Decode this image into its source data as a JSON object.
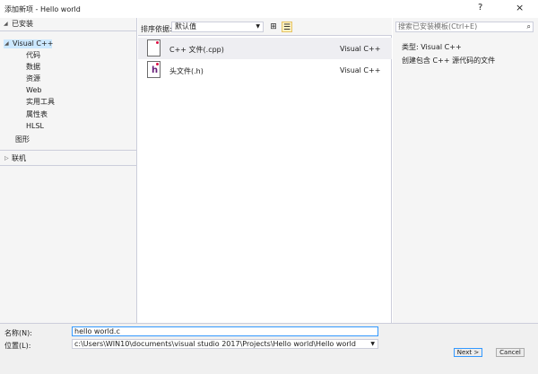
{
  "window": {
    "title": "添加新项 - Hello world",
    "help_label": "?",
    "close_label": "×"
  },
  "tree": {
    "installed_label": "已安装",
    "root_label": "Visual C++",
    "children": [
      "代码",
      "数据",
      "资源",
      "Web",
      "实用工具",
      "属性表",
      "HLSL"
    ],
    "graphics_label": "图形",
    "online_label": "联机"
  },
  "sortbar": {
    "label": "排序依据:",
    "value": "默认值",
    "grid_view_icon": "grid-icon",
    "list_view_icon": "list-icon"
  },
  "templates": [
    {
      "name": "C++ 文件(.cpp)",
      "type": "Visual C++",
      "glyph": "",
      "selected": true
    },
    {
      "name": "头文件(.h)",
      "type": "Visual C++",
      "glyph": "h",
      "selected": false
    }
  ],
  "right": {
    "search_placeholder": "搜索已安装模板(Ctrl+E)",
    "type_line": "类型:  Visual C++",
    "description": "创建包含 C++ 源代码的文件"
  },
  "form": {
    "name_label": "名称(N):",
    "name_value": "hello world.c",
    "location_label": "位置(L):",
    "location_value": "c:\\Users\\WIN10\\documents\\visual studio 2017\\Projects\\Hello world\\Hello world",
    "next_label": "Next >",
    "cancel_label": "Cancel"
  },
  "colors": {
    "selection": "#cce8ff",
    "accent": "#3399ff",
    "pane_bg": "#f5f5f5"
  }
}
